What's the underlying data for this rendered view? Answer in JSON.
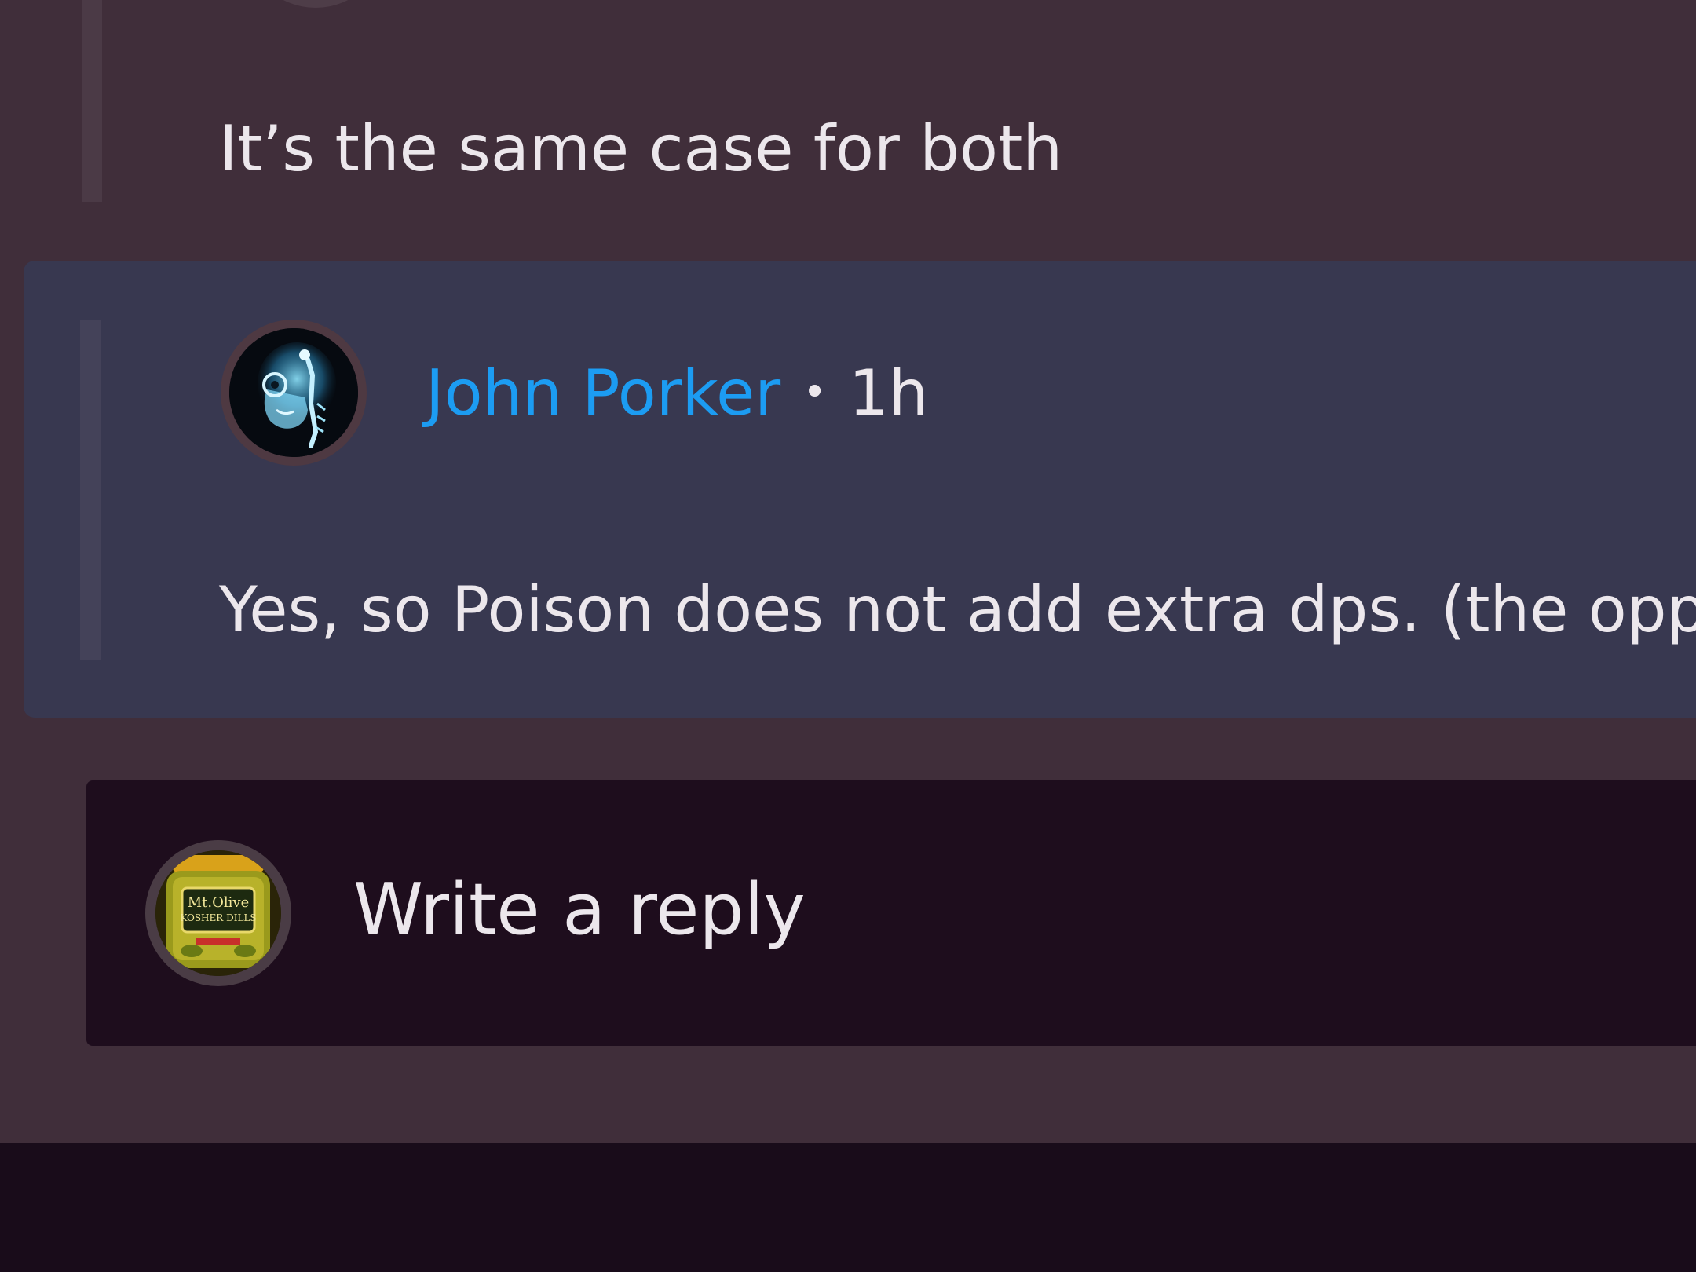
{
  "previous_comment": {
    "text": "It’s the same case for both"
  },
  "highlighted_comment": {
    "author": "John Porker",
    "separator": "•",
    "time": "1h",
    "text": "Yes, so Poison does not add extra dps. (the opp",
    "avatar_icon": "xray-skull-avatar-icon",
    "author_color": "#1c9cf2"
  },
  "reply_composer": {
    "placeholder": "Write a reply",
    "avatar_icon": "pickle-jar-avatar-icon",
    "avatar_label": "Mt.Olive KOSHER DILLS"
  },
  "colors": {
    "panel_bg": "#402e3a",
    "highlight_bg": "#383850",
    "composer_bg": "#1e0d1d",
    "page_bg": "#190c1a",
    "text": "#ece7ec"
  }
}
